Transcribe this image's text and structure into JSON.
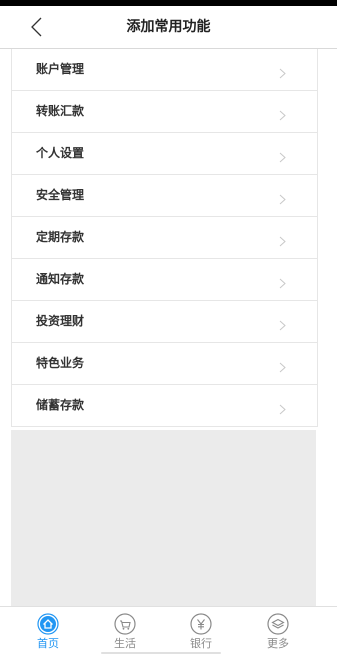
{
  "header": {
    "title": "添加常用功能"
  },
  "menu": {
    "items": [
      {
        "label": "账户管理"
      },
      {
        "label": "转账汇款"
      },
      {
        "label": "个人设置"
      },
      {
        "label": "安全管理"
      },
      {
        "label": "定期存款"
      },
      {
        "label": "通知存款"
      },
      {
        "label": "投资理财"
      },
      {
        "label": "特色业务"
      },
      {
        "label": "储蓄存款"
      }
    ]
  },
  "tabbar": {
    "tabs": [
      {
        "label": "首页",
        "icon": "home-icon",
        "active": true
      },
      {
        "label": "生活",
        "icon": "shopping-cart-icon",
        "active": false
      },
      {
        "label": "银行",
        "icon": "yen-icon",
        "active": false
      },
      {
        "label": "更多",
        "icon": "layers-icon",
        "active": false
      }
    ]
  },
  "colors": {
    "accent": "#2196f3",
    "text": "#333333",
    "inactive": "#8a8a8a",
    "background_gray": "#ebebeb"
  }
}
